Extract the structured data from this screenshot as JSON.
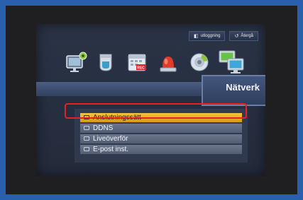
{
  "topbar": {
    "logout": {
      "label": "utloggning",
      "icon": "logout-icon"
    },
    "back": {
      "label": "Återgå",
      "icon": "return-icon"
    }
  },
  "icons": [
    {
      "name": "monitor-settings-icon"
    },
    {
      "name": "camera-icon"
    },
    {
      "name": "record-calendar-icon",
      "badge": "REC"
    },
    {
      "name": "alarm-light-icon"
    },
    {
      "name": "disk-icon"
    },
    {
      "name": "network-icon",
      "selected": true
    }
  ],
  "section": {
    "title": "Nätverk"
  },
  "menu": {
    "items": [
      {
        "label": "Anslutningssätt",
        "active": true
      },
      {
        "label": "DDNS"
      },
      {
        "label": "Liveöverför"
      },
      {
        "label": "E-post inst."
      }
    ]
  },
  "colors": {
    "background": "#2a5fae",
    "active_item": "#e0ac25",
    "highlight_border": "#e52222"
  }
}
